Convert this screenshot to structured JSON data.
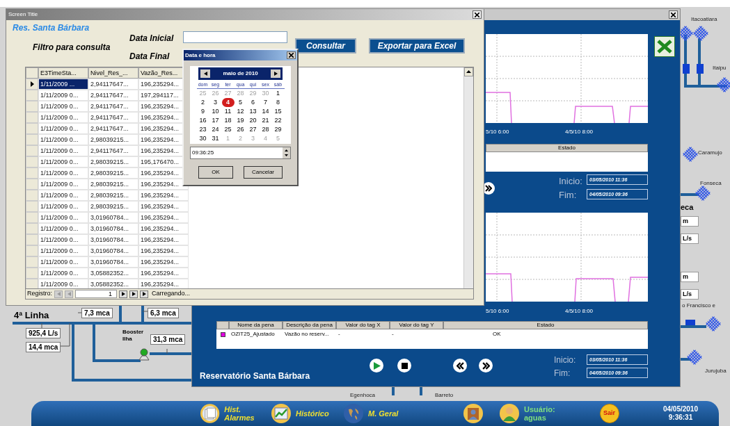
{
  "diagram": {
    "line_title": "4ª Linha",
    "readings": [
      "7,3 mca",
      "6,3 mca",
      "925,4 L/s",
      "14,4 mca",
      "31,3 mca"
    ],
    "booster": "Booster Ilha",
    "stations": [
      "Itacoatiara",
      "Itaipu",
      "Caramujo",
      "Fonseca",
      "o Francisco e",
      "Jurujuba",
      "Egenhoca",
      "Barreto"
    ],
    "station_heading": "eca",
    "units": [
      "m",
      "L/s",
      "m",
      "L/s"
    ]
  },
  "query_window": {
    "title": "Screen Title",
    "heading": "Res. Santa Bárbara",
    "filter_label": "Filtro para consulta",
    "start_label": "Data Inicial",
    "end_label": "Data Final",
    "buttons": [
      "Consultar",
      "Exportar para Excel"
    ],
    "grid": {
      "columns": [
        "E3TimeSta...",
        "Nivel_Res_...",
        "Vazão_Res..."
      ],
      "rows": [
        {
          "selected": true,
          "cells": [
            "1/11/2009 ...",
            "2,94117647...",
            "196,235294..."
          ]
        },
        {
          "selected": false,
          "cells": [
            "1/11/2009 0...",
            "2,94117647...",
            "197,294117..."
          ]
        },
        {
          "selected": false,
          "cells": [
            "1/11/2009 0...",
            "2,94117647...",
            "196,235294..."
          ]
        },
        {
          "selected": false,
          "cells": [
            "1/11/2009 0...",
            "2,94117647...",
            "196,235294..."
          ]
        },
        {
          "selected": false,
          "cells": [
            "1/11/2009 0...",
            "2,94117647...",
            "196,235294..."
          ]
        },
        {
          "selected": false,
          "cells": [
            "1/11/2009 0...",
            "2,98039215...",
            "196,235294..."
          ]
        },
        {
          "selected": false,
          "cells": [
            "1/11/2009 0...",
            "2,94117647...",
            "196,235294..."
          ]
        },
        {
          "selected": false,
          "cells": [
            "1/11/2009 0...",
            "2,98039215...",
            "195,176470..."
          ]
        },
        {
          "selected": false,
          "cells": [
            "1/11/2009 0...",
            "2,98039215...",
            "196,235294..."
          ]
        },
        {
          "selected": false,
          "cells": [
            "1/11/2009 0...",
            "2,98039215...",
            "196,235294..."
          ]
        },
        {
          "selected": false,
          "cells": [
            "1/11/2009 0...",
            "2,98039215...",
            "196,235294..."
          ]
        },
        {
          "selected": false,
          "cells": [
            "1/11/2009 0...",
            "2,98039215...",
            "196,235294..."
          ]
        },
        {
          "selected": false,
          "cells": [
            "1/11/2009 0...",
            "3,01960784...",
            "196,235294..."
          ]
        },
        {
          "selected": false,
          "cells": [
            "1/11/2009 0...",
            "3,01960784...",
            "196,235294..."
          ]
        },
        {
          "selected": false,
          "cells": [
            "1/11/2009 0...",
            "3,01960784...",
            "196,235294..."
          ]
        },
        {
          "selected": false,
          "cells": [
            "1/11/2009 0...",
            "3,01960784...",
            "196,235294..."
          ]
        },
        {
          "selected": false,
          "cells": [
            "1/11/2009 0...",
            "3,01960784...",
            "196,235294..."
          ]
        },
        {
          "selected": false,
          "cells": [
            "1/11/2009 0...",
            "3,05882352...",
            "196,235294..."
          ]
        },
        {
          "selected": false,
          "cells": [
            "1/11/2009 0...",
            "3,05882352...",
            "196,235294..."
          ]
        }
      ],
      "record_label": "Registro:",
      "record": "1",
      "status": "Carregando..."
    }
  },
  "date_picker": {
    "title": "Data e hora",
    "month": "maio de 2010",
    "weekdays": [
      "dom",
      "seg",
      "ter",
      "qua",
      "qui",
      "sex",
      "sáb"
    ],
    "weeks": [
      [
        {
          "day": "25",
          "outside": true,
          "selected": false
        },
        {
          "day": "26",
          "outside": true,
          "selected": false
        },
        {
          "day": "27",
          "outside": true,
          "selected": false
        },
        {
          "day": "28",
          "outside": true,
          "selected": false
        },
        {
          "day": "29",
          "outside": true,
          "selected": false
        },
        {
          "day": "30",
          "outside": true,
          "selected": false
        },
        {
          "day": "1",
          "outside": false,
          "selected": false
        }
      ],
      [
        {
          "day": "2",
          "outside": false,
          "selected": false
        },
        {
          "day": "3",
          "outside": false,
          "selected": false
        },
        {
          "day": "4",
          "outside": false,
          "selected": true
        },
        {
          "day": "5",
          "outside": false,
          "selected": false
        },
        {
          "day": "6",
          "outside": false,
          "selected": false
        },
        {
          "day": "7",
          "outside": false,
          "selected": false
        },
        {
          "day": "8",
          "outside": false,
          "selected": false
        }
      ],
      [
        {
          "day": "9",
          "outside": false,
          "selected": false
        },
        {
          "day": "10",
          "outside": false,
          "selected": false
        },
        {
          "day": "11",
          "outside": false,
          "selected": false
        },
        {
          "day": "12",
          "outside": false,
          "selected": false
        },
        {
          "day": "13",
          "outside": false,
          "selected": false
        },
        {
          "day": "14",
          "outside": false,
          "selected": false
        },
        {
          "day": "15",
          "outside": false,
          "selected": false
        }
      ],
      [
        {
          "day": "16",
          "outside": false,
          "selected": false
        },
        {
          "day": "17",
          "outside": false,
          "selected": false
        },
        {
          "day": "18",
          "outside": false,
          "selected": false
        },
        {
          "day": "19",
          "outside": false,
          "selected": false
        },
        {
          "day": "20",
          "outside": false,
          "selected": false
        },
        {
          "day": "21",
          "outside": false,
          "selected": false
        },
        {
          "day": "22",
          "outside": false,
          "selected": false
        }
      ],
      [
        {
          "day": "23",
          "outside": false,
          "selected": false
        },
        {
          "day": "24",
          "outside": false,
          "selected": false
        },
        {
          "day": "25",
          "outside": false,
          "selected": false
        },
        {
          "day": "26",
          "outside": false,
          "selected": false
        },
        {
          "day": "27",
          "outside": false,
          "selected": false
        },
        {
          "day": "28",
          "outside": false,
          "selected": false
        },
        {
          "day": "29",
          "outside": false,
          "selected": false
        }
      ],
      [
        {
          "day": "30",
          "outside": false,
          "selected": false
        },
        {
          "day": "31",
          "outside": false,
          "selected": false
        },
        {
          "day": "1",
          "outside": true,
          "selected": false
        },
        {
          "day": "2",
          "outside": true,
          "selected": false
        },
        {
          "day": "3",
          "outside": true,
          "selected": false
        },
        {
          "day": "4",
          "outside": true,
          "selected": false
        },
        {
          "day": "5",
          "outside": true,
          "selected": false
        }
      ]
    ],
    "time": "09:36:25",
    "buttons": [
      "OK",
      "Cancelar"
    ]
  },
  "trend_window": {
    "upper": {
      "x_labels": [
        "5/10 6:00",
        "4/5/10 8:00"
      ],
      "legend_header": "Estado",
      "start_label": "Inicio:",
      "start": "03/05/2010 11:36",
      "end_label": "Fim:",
      "end": "04/05/2010 09:36"
    },
    "lower_chart": {
      "x_labels": [
        "5/10 6:00",
        "4/5/10 8:00"
      ]
    },
    "legend": {
      "columns": [
        "Nome da pena",
        "Descrição da pena",
        "Valor do tag X",
        "Valor do tag Y",
        "Estado"
      ],
      "rows": [
        {
          "color": "#e000e0",
          "cells": [
            "OZIT25_Ajustado",
            "Vazão no reserv...",
            "-",
            "-",
            "OK"
          ]
        }
      ]
    },
    "title": "Reservatório Santa Bárbara",
    "start_label": "Inicio:",
    "start": "03/05/2010 11:36",
    "end_label": "Fim:",
    "end": "04/05/2010 09:36"
  },
  "taskbar": {
    "items": [
      {
        "kind": "alarms",
        "label": "Hist. Alarmes"
      },
      {
        "kind": "history",
        "label": "Histórico"
      },
      {
        "kind": "map",
        "label": "M. Geral"
      },
      {
        "kind": "report"
      }
    ],
    "user_label": "Usuário:",
    "user": "aguas",
    "exit": "Sair",
    "date": "04/05/2010",
    "time": "9:36:31"
  }
}
